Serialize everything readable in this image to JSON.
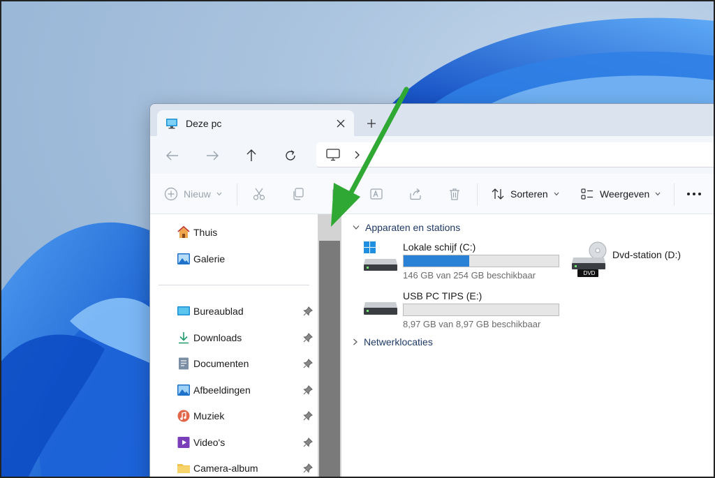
{
  "tab": {
    "title": "Deze pc"
  },
  "toolbar": {
    "new_label": "Nieuw",
    "sort_label": "Sorteren",
    "view_label": "Weergeven"
  },
  "sidebar": {
    "items": [
      {
        "label": "Thuis",
        "icon": "home-icon",
        "pinned": false
      },
      {
        "label": "Galerie",
        "icon": "gallery-icon",
        "pinned": false
      },
      {
        "label": "Bureaublad",
        "icon": "desktop-icon",
        "pinned": true
      },
      {
        "label": "Downloads",
        "icon": "download-icon",
        "pinned": true
      },
      {
        "label": "Documenten",
        "icon": "document-icon",
        "pinned": true
      },
      {
        "label": "Afbeeldingen",
        "icon": "pictures-icon",
        "pinned": true
      },
      {
        "label": "Muziek",
        "icon": "music-icon",
        "pinned": true
      },
      {
        "label": "Video's",
        "icon": "video-icon",
        "pinned": true
      },
      {
        "label": "Camera-album",
        "icon": "folder-icon",
        "pinned": true
      }
    ]
  },
  "main": {
    "groups": [
      {
        "label": "Apparaten en stations",
        "expanded": true
      },
      {
        "label": "Netwerklocaties",
        "expanded": false
      }
    ],
    "drives": [
      {
        "name": "Lokale schijf (C:)",
        "free": "146 GB van 254 GB beschikbaar",
        "used_fraction": 0.425,
        "icon": "system-drive-icon"
      },
      {
        "name": "USB PC TIPS (E:)",
        "free": "8,97 GB van 8,97 GB beschikbaar",
        "used_fraction": 0.0,
        "icon": "usb-drive-icon"
      },
      {
        "name": "Dvd-station (D:)",
        "icon": "dvd-drive-icon",
        "badge": "DVD"
      }
    ]
  },
  "colors": {
    "accent": "#2a82d6",
    "arrow": "#2fa834",
    "scroll_thumb": "#7a7a7a"
  }
}
